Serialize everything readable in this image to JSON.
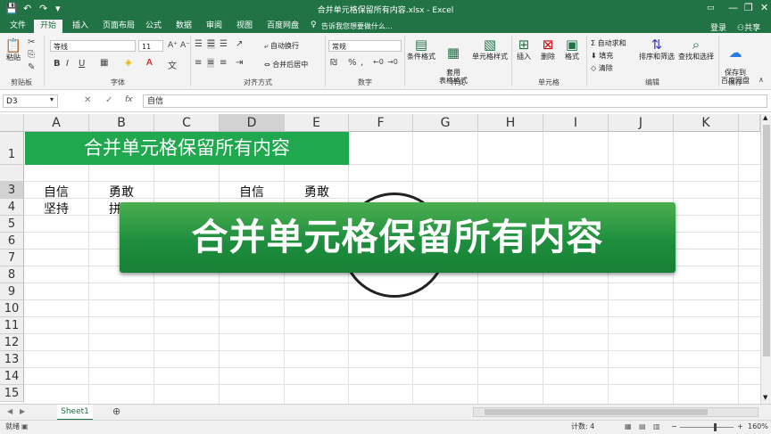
{
  "window": {
    "title": "合并单元格保留所有内容.xlsx - Excel",
    "login": "登录",
    "share": "共享",
    "controls": [
      "—",
      "❐",
      "✕"
    ]
  },
  "qat": [
    "💾",
    "↶",
    "↷",
    "▾"
  ],
  "tabs": [
    "文件",
    "开始",
    "插入",
    "页面布局",
    "公式",
    "数据",
    "审阅",
    "视图",
    "百度网盘"
  ],
  "active_tab": "开始",
  "tell_me": "告诉我您想要做什么...",
  "ribbon": {
    "clipboard": {
      "paste": "粘贴",
      "label": "剪贴板"
    },
    "font": {
      "name": "等线",
      "size": "11",
      "label": "字体",
      "bold": "B",
      "italic": "I",
      "underline": "U"
    },
    "alignment": {
      "wrap": "自动换行",
      "merge": "合并后居中",
      "label": "对齐方式"
    },
    "number": {
      "format": "常规",
      "label": "数字",
      "percent": "%",
      "comma": ","
    },
    "styles": {
      "conditional": "条件格式",
      "table": "套用\n表格格式",
      "cell": "单元格样式",
      "label": "样式"
    },
    "cells": {
      "insert": "插入",
      "delete": "删除",
      "format": "格式",
      "label": "单元格"
    },
    "editing": {
      "autosum": "自动求和",
      "fill": "填充",
      "clear": "清除",
      "sort": "排序和筛选",
      "find": "查找和选择",
      "label": "编辑"
    },
    "save": {
      "save_to": "保存到\n百度网盘",
      "label": "保存"
    }
  },
  "formula_bar": {
    "name_box": "D3",
    "cancel": "✕",
    "enter": "✓",
    "fx": "fx",
    "value": "自信"
  },
  "columns": [
    "A",
    "B",
    "C",
    "D",
    "E",
    "F",
    "G",
    "H",
    "I",
    "J",
    "K"
  ],
  "rows": [
    "1",
    "3",
    "4",
    "5",
    "6",
    "7",
    "8",
    "9",
    "10",
    "11",
    "12",
    "13",
    "14",
    "15"
  ],
  "cells": {
    "merged_title": "合并单元格保留所有内容",
    "A3": "自信",
    "B3": "勇敢",
    "D3": "自信",
    "E3": "勇敢",
    "A4": "坚持",
    "B4": "拼"
  },
  "banner_text": "合并单元格保留所有内容",
  "sheet_tabs": [
    "Sheet1"
  ],
  "add_sheet": "⊕",
  "status": {
    "ready": "就绪",
    "count": "计数: 4",
    "zoom": "160%"
  }
}
